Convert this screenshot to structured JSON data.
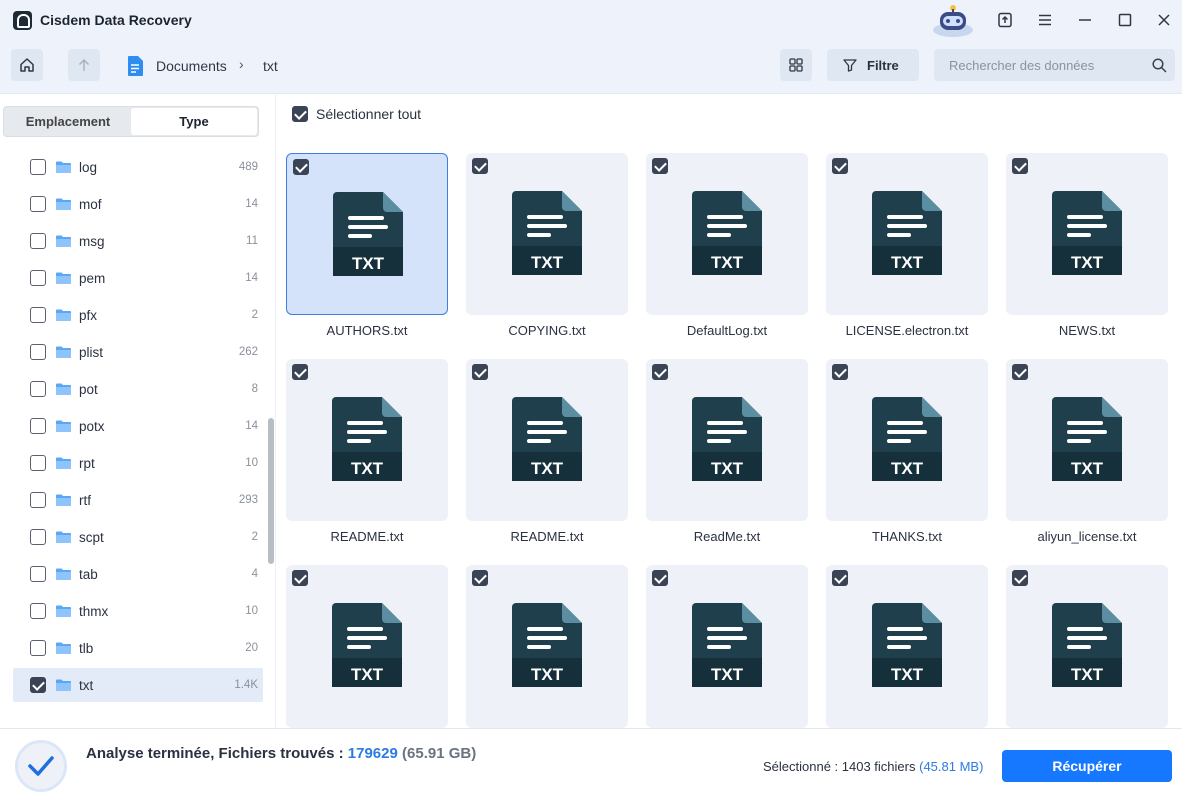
{
  "app": {
    "title": "Cisdem Data Recovery"
  },
  "window_controls": [
    "upload-icon",
    "menu-icon",
    "minimize-icon",
    "maximize-icon",
    "close-icon"
  ],
  "breadcrumb": {
    "folder": "Documents",
    "current": "txt"
  },
  "toolbar": {
    "filter_label": "Filtre",
    "search_placeholder": "Rechercher des données"
  },
  "sidebar": {
    "tabs": {
      "location": "Emplacement",
      "type": "Type"
    },
    "types": [
      {
        "name": "log",
        "count": "489",
        "checked": false
      },
      {
        "name": "mof",
        "count": "14",
        "checked": false
      },
      {
        "name": "msg",
        "count": "11",
        "checked": false
      },
      {
        "name": "pem",
        "count": "14",
        "checked": false
      },
      {
        "name": "pfx",
        "count": "2",
        "checked": false
      },
      {
        "name": "plist",
        "count": "262",
        "checked": false
      },
      {
        "name": "pot",
        "count": "8",
        "checked": false
      },
      {
        "name": "potx",
        "count": "14",
        "checked": false
      },
      {
        "name": "rpt",
        "count": "10",
        "checked": false
      },
      {
        "name": "rtf",
        "count": "293",
        "checked": false
      },
      {
        "name": "scpt",
        "count": "2",
        "checked": false
      },
      {
        "name": "tab",
        "count": "4",
        "checked": false
      },
      {
        "name": "thmx",
        "count": "10",
        "checked": false
      },
      {
        "name": "tlb",
        "count": "20",
        "checked": false
      },
      {
        "name": "txt",
        "count": "1.4K",
        "checked": true
      }
    ]
  },
  "main": {
    "select_all_label": "Sélectionner tout",
    "icon_label": "TXT",
    "files": [
      {
        "name": "AUTHORS.txt"
      },
      {
        "name": "COPYING.txt"
      },
      {
        "name": "DefaultLog.txt"
      },
      {
        "name": "LICENSE.electron.txt"
      },
      {
        "name": "NEWS.txt"
      },
      {
        "name": "README.txt"
      },
      {
        "name": "README.txt"
      },
      {
        "name": "ReadMe.txt"
      },
      {
        "name": "THANKS.txt"
      },
      {
        "name": "aliyun_license.txt"
      },
      {
        "name": ""
      },
      {
        "name": ""
      },
      {
        "name": ""
      },
      {
        "name": ""
      },
      {
        "name": ""
      }
    ]
  },
  "status": {
    "text": "Analyse terminée, Fichiers trouvés : ",
    "found_count": "179629",
    "found_size": "(65.91 GB)",
    "selected_text": "Sélectionné : 1403 fichiers ",
    "selected_size": "(45.81 MB)",
    "recover_label": "Récupérer"
  },
  "colors": {
    "accent": "#1677ff",
    "icon_dark": "#1f3f4c",
    "selected_tile": "#d4e3fa"
  }
}
